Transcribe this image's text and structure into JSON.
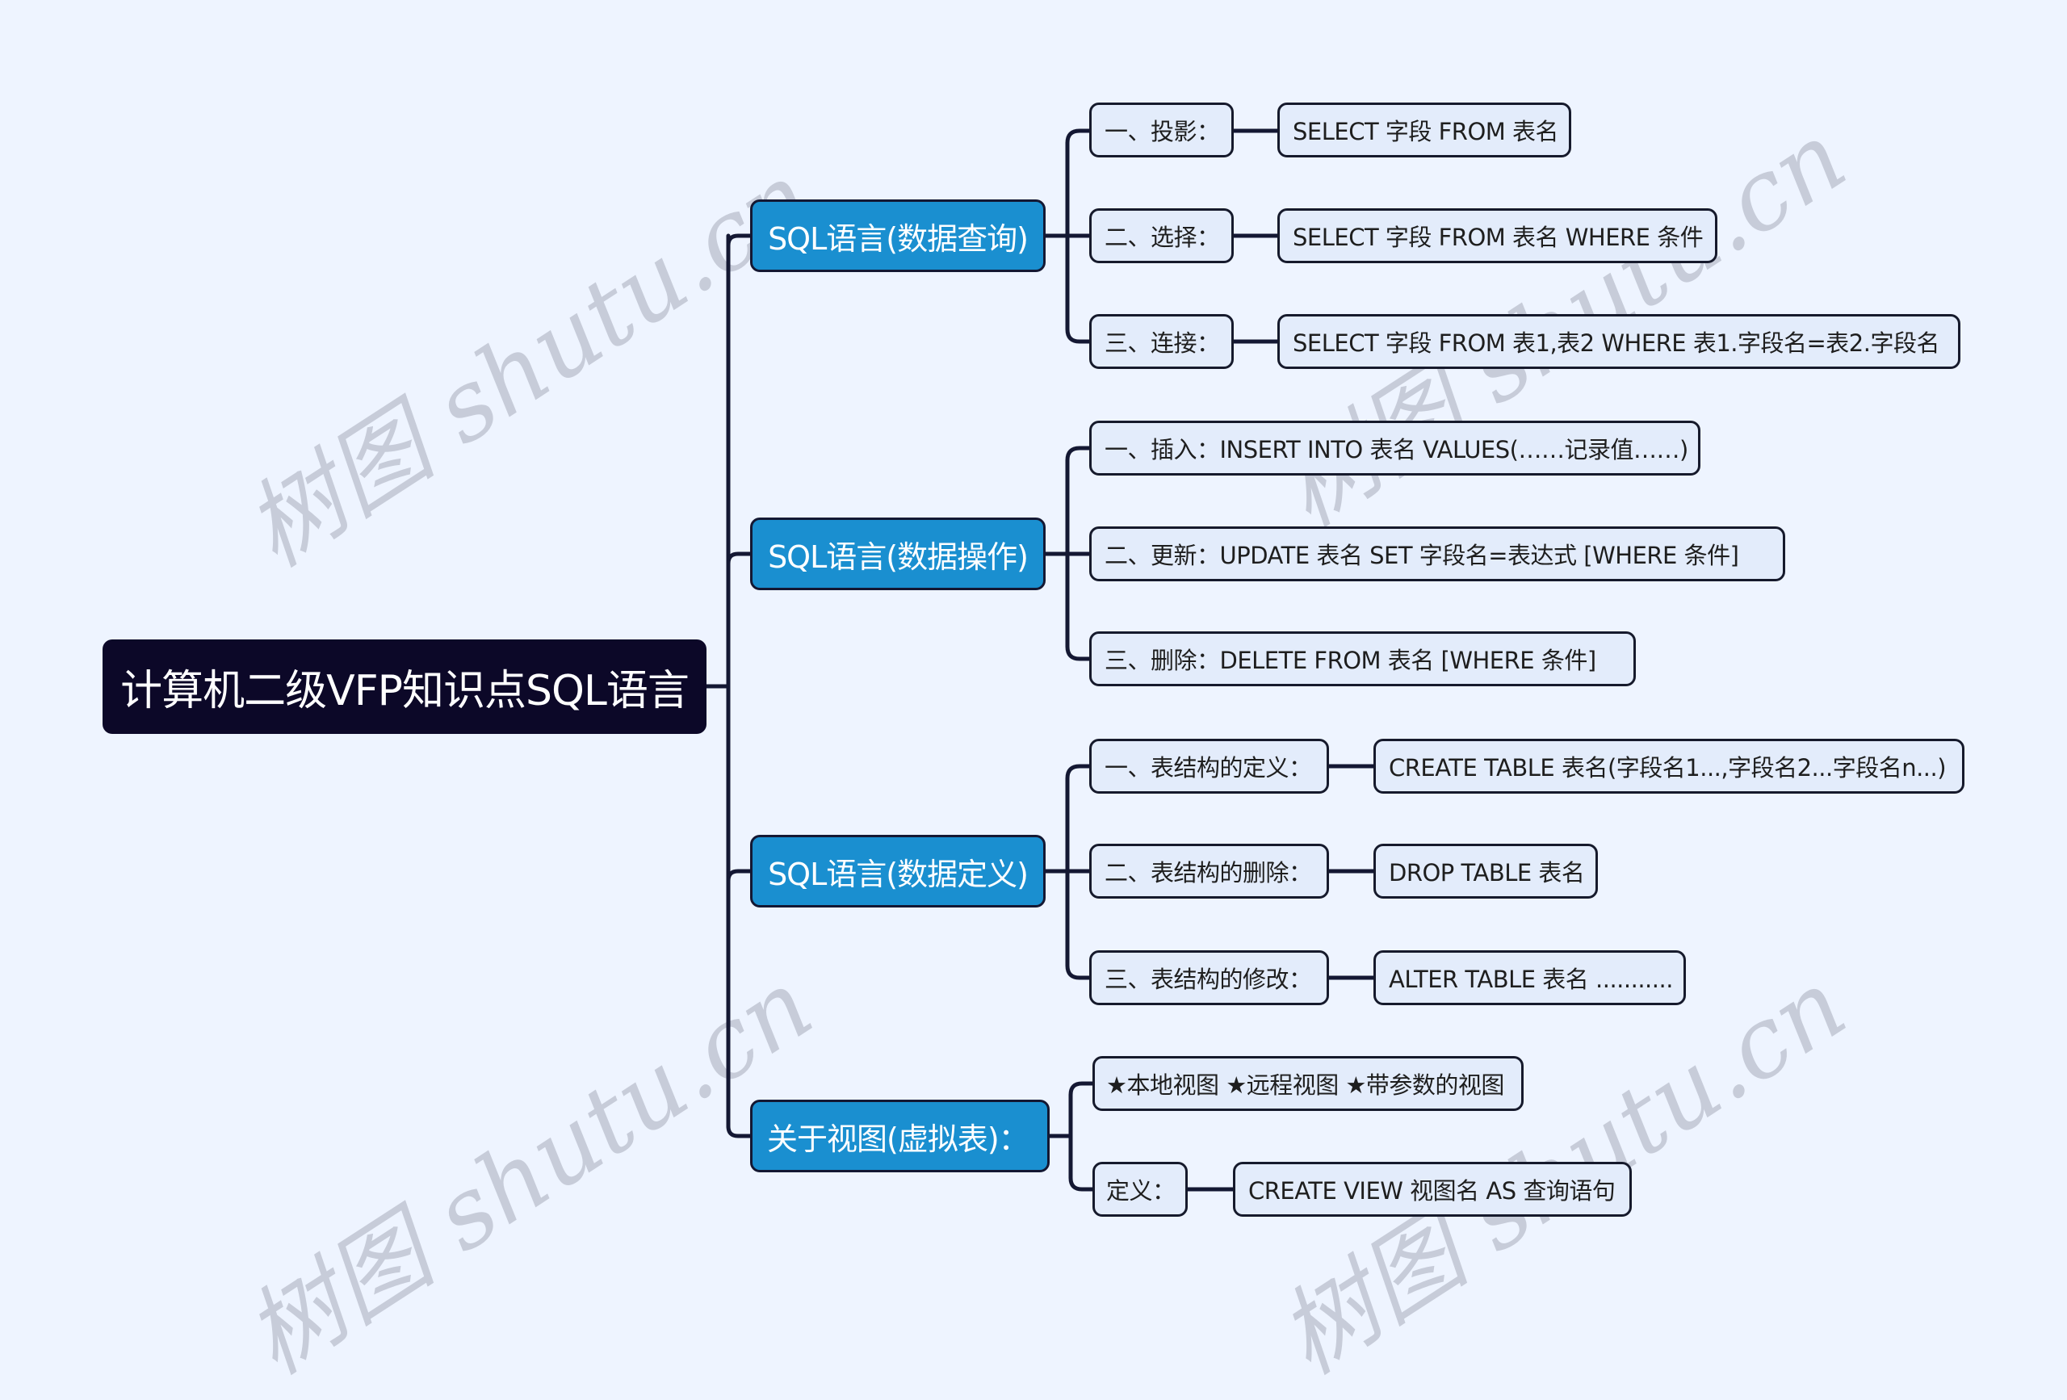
{
  "mindmap": {
    "root": "计算机二级VFP知识点SQL语言",
    "branches": [
      {
        "label": "SQL语言(数据查询)",
        "children": [
          {
            "label": "一、投影：",
            "detail": "SELECT 字段 FROM 表名"
          },
          {
            "label": "二、选择：",
            "detail": "SELECT 字段 FROM 表名 WHERE 条件"
          },
          {
            "label": "三、连接：",
            "detail": "SELECT 字段 FROM 表1,表2 WHERE 表1.字段名=表2.字段名"
          }
        ]
      },
      {
        "label": "SQL语言(数据操作)",
        "children": [
          {
            "label": "一、插入：INSERT INTO 表名 VALUES(……记录值……)"
          },
          {
            "label": "二、更新：UPDATE 表名 SET 字段名=表达式 [WHERE 条件]"
          },
          {
            "label": "三、删除：DELETE FROM 表名 [WHERE 条件]"
          }
        ]
      },
      {
        "label": "SQL语言(数据定义)",
        "children": [
          {
            "label": "一、表结构的定义：",
            "detail": "CREATE TABLE 表名(字段名1...,字段名2...字段名n...)"
          },
          {
            "label": "二、表结构的删除：",
            "detail": "DROP TABLE 表名"
          },
          {
            "label": "三、表结构的修改：",
            "detail": "ALTER TABLE 表名 ..........."
          }
        ]
      },
      {
        "label": "关于视图(虚拟表)：",
        "children": [
          {
            "label": "★本地视图 ★远程视图 ★带参数的视图"
          },
          {
            "label": "定义：",
            "detail": "CREATE VIEW 视图名 AS 查询语句"
          }
        ]
      }
    ]
  },
  "watermark": "树图 shutu.cn",
  "colors": {
    "background": "#eef4ff",
    "root_fill": "#0c0828",
    "branch_fill": "#1a8fd0",
    "leaf_fill": "#e3ecfb",
    "line": "#141833"
  }
}
